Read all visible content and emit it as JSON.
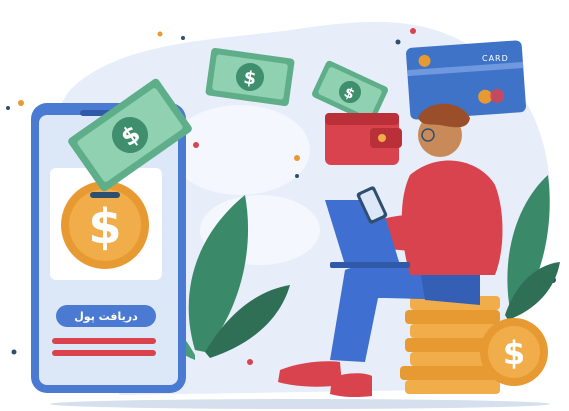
{
  "phone": {
    "button_label": "دریافت پول",
    "icon": "dollar-coin-icon"
  },
  "credit_card": {
    "label": "CARD",
    "icon": "credit-card-icon"
  },
  "icons": {
    "banknote": "banknote-icon",
    "wallet": "wallet-icon",
    "coin_stack": "coin-stack-icon",
    "tablet": "tablet-icon",
    "plant": "plant-icon"
  },
  "colors": {
    "blob": "#e7eef9",
    "phone_blue": "#4a7ad1",
    "screen": "#dce8f7",
    "button": "#4a7ad1",
    "bar_red": "#d9434d",
    "coin_orange": "#e89a32",
    "banknote_green": "#5fae8a",
    "hoodie_red": "#d9434d",
    "jeans_blue": "#3f6fd0",
    "plant_green": "#3a8a6a",
    "card_blue": "#3f73c8"
  }
}
